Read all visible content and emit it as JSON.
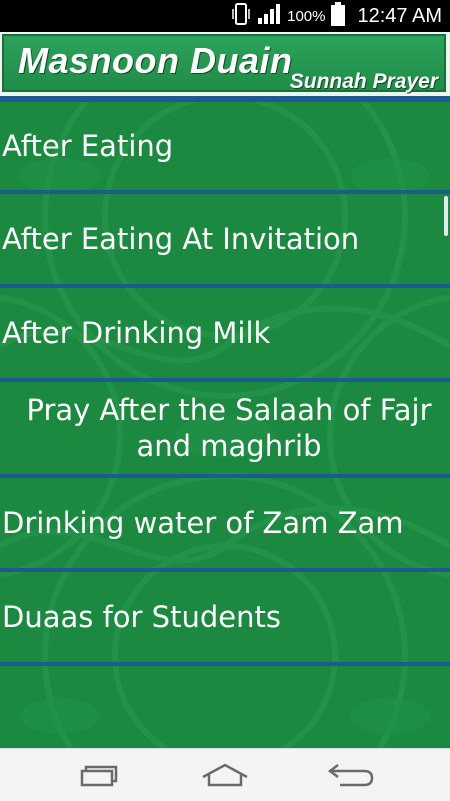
{
  "status_bar": {
    "battery_percent": "100%",
    "time": "12:47 AM",
    "icons": [
      "vibrate-icon",
      "signal-icon",
      "battery-icon"
    ]
  },
  "header": {
    "title": "Masnoon Duain",
    "subtitle": "Sunnah Prayer"
  },
  "list": {
    "items": [
      {
        "label": "After Eating"
      },
      {
        "label": "After Eating At Invitation"
      },
      {
        "label": "After Drinking Milk"
      },
      {
        "label": "Pray After the Salaah of Fajr and maghrib"
      },
      {
        "label": "Drinking water of Zam Zam"
      },
      {
        "label": "Duaas for Students"
      }
    ]
  },
  "nav": {
    "icons": [
      "recent-apps-icon",
      "home-icon",
      "back-icon"
    ]
  },
  "colors": {
    "background_green": "#1b8a40",
    "divider_blue": "#1b5b8e",
    "banner_green": "#2ba35a"
  }
}
